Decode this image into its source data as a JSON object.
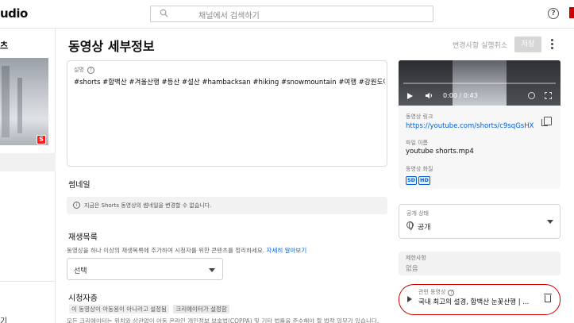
{
  "app": {
    "brand": "udio"
  },
  "search": {
    "placeholder": "채널에서 검색하기"
  },
  "sidebar": {
    "title": "츠",
    "bottom_label": "기"
  },
  "header": {
    "title": "동영상 세부정보",
    "undo_label": "변경사항 실행취소",
    "save_label": "저장"
  },
  "description": {
    "label": "설명",
    "text": "#shorts #함백산 #겨울산행 #등산 #설산 #hambacksan #hiking #snowmountain #여행 #강원도여행"
  },
  "thumbnail": {
    "label": "썸네일",
    "notice": "지금은 Shorts 동영상의 썸네일을 변경할 수 없습니다."
  },
  "playlist": {
    "label": "재생목록",
    "description": "동영상을 하나 이상의 재생목록에 추가하여 시청자를 위한 콘텐츠를 정리하세요.",
    "link": "자세히 알아보기",
    "select_value": "선택"
  },
  "audience": {
    "label": "시청자층",
    "line1_prefix": "이 동영상이 아동용이 아니라고 설정됨",
    "chip": "크리에이터가 설정함",
    "line2": "모든 크리에이터는 위치와 상관없이 아동 온라인 개인정보 보호법(COPPA) 및 기타 법률을 준수해야 할 법적 의무가 있습니다."
  },
  "video": {
    "time": "0:00 / 0:43",
    "link_label": "동영상 링크",
    "link": "https://youtube.com/shorts/c9sqGsHX...",
    "file_label": "파일 이름",
    "file_name": "youtube shorts.mp4",
    "quality_label": "동영상 화질",
    "quality": [
      "SD",
      "HD"
    ]
  },
  "visibility": {
    "label": "공개 상태",
    "value": "공개"
  },
  "restrictions": {
    "label": "제한사항",
    "value": "없음"
  },
  "related": {
    "label": "관련 동영상",
    "title": "국내 최고의 설경, 함백산 눈꽃산행 | ..."
  },
  "colors": {
    "accent_link": "#065fd4",
    "highlight_ring": "#d40000",
    "shorts_red": "#ff1a1a"
  }
}
